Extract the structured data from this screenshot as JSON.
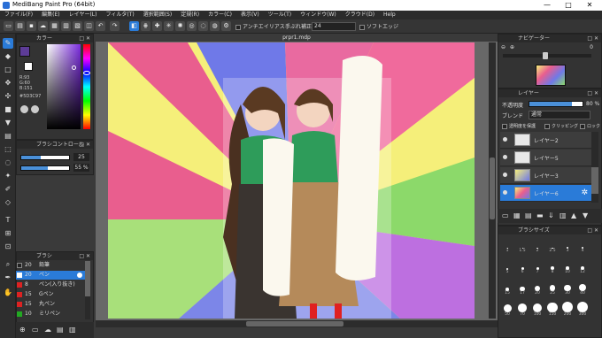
{
  "app": {
    "title": "MediBang Paint Pro (64bit)"
  },
  "window_controls": [
    "—",
    "□",
    "✕"
  ],
  "menu": [
    "ファイル(F)",
    "編集(E)",
    "レイヤー(L)",
    "フィルタ(T)",
    "選択範囲(S)",
    "定規(R)",
    "カラー(C)",
    "表示(V)",
    "ツール(T)",
    "ウィンドウ(W)",
    "クラウド(D)",
    "Help"
  ],
  "toolbar": {
    "antialias_label": "アンチエイリアス",
    "correction_label": "手ぶれ補正",
    "correction_value": "24",
    "soft_edge_label": "ソフトエッジ"
  },
  "color_panel": {
    "title": "カラー",
    "r": "R:93",
    "g": "G:60",
    "b": "B:151",
    "hex": "#5D3C97"
  },
  "brush_control": {
    "title": "ブラシコントロール",
    "size_value": "25",
    "opacity_value": "55 %"
  },
  "brush_panel": {
    "title": "ブラシ",
    "items": [
      {
        "size": "20",
        "name": "鉛筆",
        "color": "#222222"
      },
      {
        "size": "20",
        "name": "ペン",
        "color": "#2a7bd8"
      },
      {
        "size": "8",
        "name": "ペン(入り抜き)",
        "color": "#dd2222"
      },
      {
        "size": "15",
        "name": "Gペン",
        "color": "#dd2222"
      },
      {
        "size": "15",
        "name": "丸ペン",
        "color": "#dd2222"
      },
      {
        "size": "10",
        "name": "ミリペン",
        "color": "#22aa22"
      }
    ]
  },
  "canvas": {
    "tab_title": "prpr1.mdp"
  },
  "navigator": {
    "title": "ナビゲーター",
    "zoom": "0"
  },
  "layer_panel": {
    "title": "レイヤー",
    "opacity_label": "不透明度",
    "opacity_value": "80 %",
    "blend_label": "ブレンド",
    "blend_value": "通常",
    "protect_label": "透明度を保護",
    "clipping_label": "クリッピング",
    "lock_label": "ロック",
    "layers": [
      {
        "name": "レイヤー2"
      },
      {
        "name": "レイヤー5"
      },
      {
        "name": "レイヤー3"
      },
      {
        "name": "レイヤー6"
      }
    ]
  },
  "brush_size_panel": {
    "title": "ブラシサイズ",
    "sizes": [
      "1",
      "1.5",
      "2",
      "2.5",
      "3",
      "4",
      "5",
      "6",
      "7",
      "8",
      "10",
      "12",
      "15",
      "17",
      "20",
      "25",
      "30",
      "40",
      "50",
      "70",
      "100",
      "150",
      "200",
      "300"
    ]
  },
  "colors": {
    "accent": "#2a7bd8",
    "panel": "#333333"
  }
}
